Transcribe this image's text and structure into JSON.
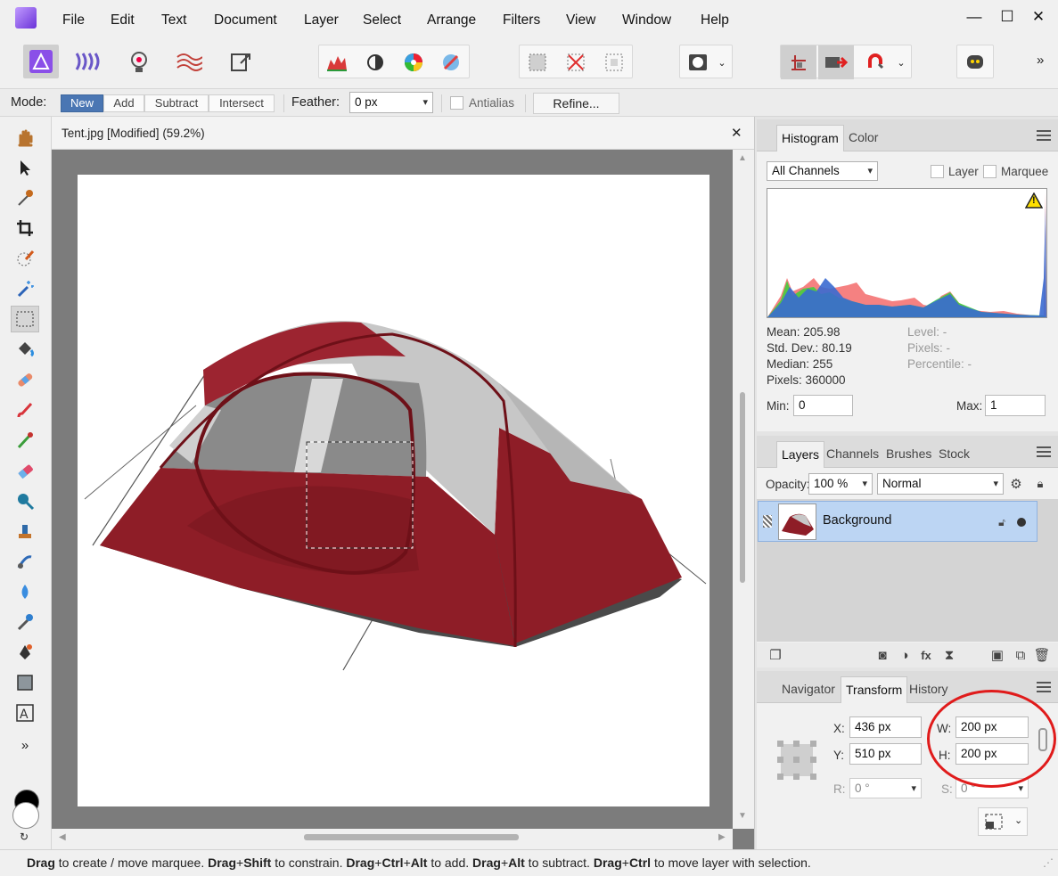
{
  "menu": [
    "File",
    "Edit",
    "Text",
    "Document",
    "Layer",
    "Select",
    "Arrange",
    "Filters",
    "View",
    "Window",
    "Help"
  ],
  "window_controls": {
    "minimize": "—",
    "maximize": "☐",
    "close": "✕"
  },
  "context_bar": {
    "mode_label": "Mode:",
    "modes": [
      "New",
      "Add",
      "Subtract",
      "Intersect"
    ],
    "active_mode": "New",
    "feather_label": "Feather:",
    "feather_value": "0 px",
    "antialias_label": "Antialias",
    "refine_label": "Refine..."
  },
  "toolbar_overflow": "»",
  "tools_overflow": "»",
  "document": {
    "tab_title": "Tent.jpg [Modified] (59.2%)",
    "close": "✕"
  },
  "histogram_panel": {
    "tabs": [
      "Histogram",
      "Color"
    ],
    "channel": "All Channels",
    "layer_label": "Layer",
    "marquee_label": "Marquee",
    "warning": "!",
    "stats_left": [
      "Mean: 205.98",
      "Std. Dev.: 80.19",
      "Median: 255",
      "Pixels: 360000"
    ],
    "stats_right": [
      "Level: -",
      "Pixels: -",
      "Percentile: -"
    ],
    "min_label": "Min:",
    "min_value": "0",
    "max_label": "Max:",
    "max_value": "1"
  },
  "layers_panel": {
    "tabs": [
      "Layers",
      "Channels",
      "Brushes",
      "Stock"
    ],
    "opacity_label": "Opacity:",
    "opacity_value": "100 %",
    "blend_mode": "Normal",
    "layer_name": "Background"
  },
  "transform_panel": {
    "tabs": [
      "Navigator",
      "Transform",
      "History"
    ],
    "x_label": "X:",
    "x_value": "436 px",
    "y_label": "Y:",
    "y_value": "510 px",
    "w_label": "W:",
    "w_value": "200 px",
    "h_label": "H:",
    "h_value": "200 px",
    "r_label": "R:",
    "r_value": "0 °",
    "s_label": "S:",
    "s_value": "0 °"
  },
  "status_bar": [
    {
      "text": "Drag",
      "bold": true
    },
    {
      "text": " to create / move marquee. ",
      "bold": false
    },
    {
      "text": "Drag",
      "bold": true
    },
    {
      "text": "+",
      "bold": false
    },
    {
      "text": "Shift",
      "bold": true
    },
    {
      "text": " to constrain. ",
      "bold": false
    },
    {
      "text": "Drag",
      "bold": true
    },
    {
      "text": "+",
      "bold": false
    },
    {
      "text": "Ctrl",
      "bold": true
    },
    {
      "text": "+",
      "bold": false
    },
    {
      "text": "Alt",
      "bold": true
    },
    {
      "text": " to add. ",
      "bold": false
    },
    {
      "text": "Drag",
      "bold": true
    },
    {
      "text": "+",
      "bold": false
    },
    {
      "text": "Alt",
      "bold": true
    },
    {
      "text": " to subtract. ",
      "bold": false
    },
    {
      "text": "Drag",
      "bold": true
    },
    {
      "text": "+",
      "bold": false
    },
    {
      "text": "Ctrl",
      "bold": true
    },
    {
      "text": " to move layer with selection.",
      "bold": false
    }
  ],
  "colors": {
    "accent": "#4a76b3",
    "layer_selected": "#bcd5f3",
    "annotation": "#e01b1b",
    "tent_red": "#8e1d27",
    "tent_grey": "#c8c8c8"
  }
}
